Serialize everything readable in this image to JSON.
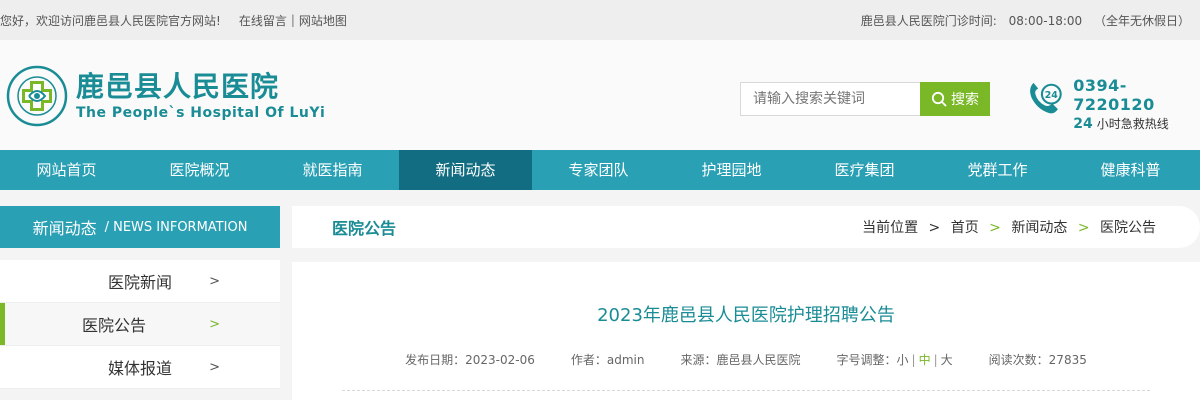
{
  "topbar": {
    "welcome": "您好，欢迎访问鹿邑县人民医院官方网站!",
    "link_message": "在线留言",
    "separator": "|",
    "link_sitemap": "网站地图",
    "hours_label": "鹿邑县人民医院门诊时间:",
    "hours": "08:00-18:00",
    "hours_note": "（全年无休假日）"
  },
  "header": {
    "logo_cn": "鹿邑县人民医院",
    "logo_en": "The People`s Hospital Of LuYi",
    "search_placeholder": "请输入搜索关键词",
    "search_button": "搜索",
    "hotline_number": "0394-7220120",
    "hotline_24": "24",
    "hotline_text": "小时急救热线",
    "icon_badge": "24"
  },
  "nav": [
    {
      "label": "网站首页"
    },
    {
      "label": "医院概况"
    },
    {
      "label": "就医指南"
    },
    {
      "label": "新闻动态"
    },
    {
      "label": "专家团队"
    },
    {
      "label": "护理园地"
    },
    {
      "label": "医疗集团"
    },
    {
      "label": "党群工作"
    },
    {
      "label": "健康科普"
    }
  ],
  "nav_active_index": 3,
  "sidebar": {
    "title_cn": "新闻动态",
    "title_en": "/ NEWS INFORMATION",
    "items": [
      {
        "label": "医院新闻",
        "chevron": ">"
      },
      {
        "label": "医院公告",
        "chevron": ">"
      },
      {
        "label": "媒体报道",
        "chevron": ">"
      }
    ],
    "active_index": 1
  },
  "main": {
    "section_title": "医院公告",
    "breadcrumb": {
      "prefix": "当前位置",
      "arrow": ">",
      "items": [
        "首页",
        "新闻动态",
        "医院公告"
      ]
    },
    "article": {
      "title": "2023年鹿邑县人民医院护理招聘公告",
      "date_label": "发布日期：2023-02-06",
      "author_label": "作者：admin",
      "source_label": "来源：鹿邑县人民医院",
      "font_label": "字号调整：",
      "font_small": "小",
      "font_mid": "中",
      "font_large": "大",
      "views_label": "阅读次数：27835"
    }
  },
  "colors": {
    "teal": "#2aa0b5",
    "teal_dark": "#126c82",
    "green": "#7ab828",
    "brand_text": "#1a8c95"
  }
}
